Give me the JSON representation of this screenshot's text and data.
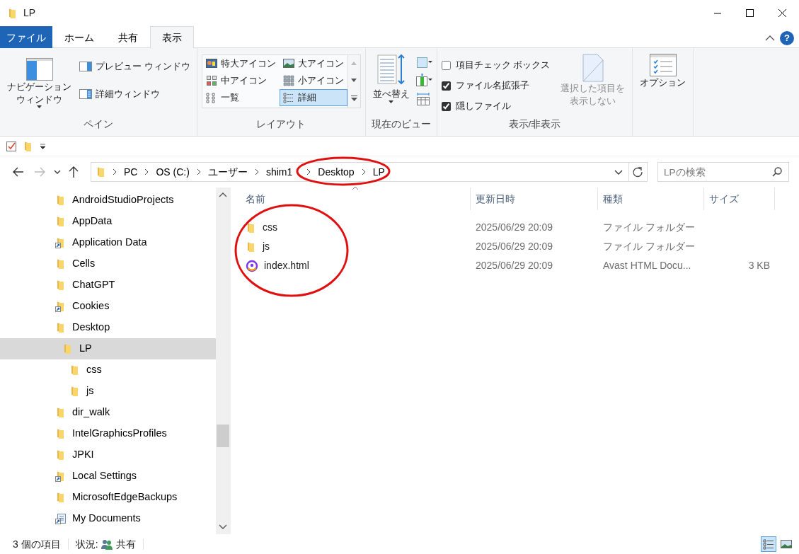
{
  "window": {
    "title": "LP"
  },
  "ribbon_tabs": [
    {
      "label": "ファイル",
      "kind": "file",
      "selected": false
    },
    {
      "label": "ホーム",
      "kind": "tab",
      "selected": false
    },
    {
      "label": "共有",
      "kind": "tab",
      "selected": false
    },
    {
      "label": "表示",
      "kind": "tab",
      "selected": true
    }
  ],
  "help": "?",
  "ribbon_groups": [
    {
      "kind": "panes",
      "label": "ペイン",
      "large": {
        "lines": [
          "ナビゲーション",
          "ウィンドウ"
        ],
        "dropdown": true
      },
      "small": [
        {
          "label": "プレビュー ウィンドウ"
        },
        {
          "label": "詳細ウィンドウ"
        }
      ]
    },
    {
      "kind": "layout",
      "label": "レイアウト",
      "items": [
        {
          "label": "特大アイコン",
          "selected": false
        },
        {
          "label": "大アイコン",
          "selected": false
        },
        {
          "label": "中アイコン",
          "selected": false
        },
        {
          "label": "小アイコン",
          "selected": false
        },
        {
          "label": "一覧",
          "selected": false
        },
        {
          "label": "詳細",
          "selected": true
        }
      ]
    },
    {
      "kind": "view",
      "label": "現在のビュー",
      "large": {
        "lines": [
          "並べ替え"
        ],
        "dropdown": true
      }
    },
    {
      "kind": "showhide",
      "label": "表示/非表示",
      "checks": [
        {
          "label": "項目チェック ボックス",
          "checked": false
        },
        {
          "label": "ファイル名拡張子",
          "checked": true
        },
        {
          "label": "隠しファイル",
          "checked": true
        }
      ],
      "large": {
        "lines": [
          "選択した項目を",
          "表示しない"
        ],
        "disabled": true
      }
    },
    {
      "kind": "options",
      "large": {
        "lines": [
          "オプション"
        ]
      }
    }
  ],
  "address_bar": {
    "crumbs": [
      {
        "label": "PC",
        "circled": false
      },
      {
        "label": "OS (C:)",
        "circled": false
      },
      {
        "label": "ユーザー",
        "circled": false
      },
      {
        "label": "shim1",
        "circled": false
      },
      {
        "label": "Desktop",
        "circled": true
      },
      {
        "label": "LP",
        "circled": true
      }
    ],
    "search": {
      "placeholder": "LPの検索"
    }
  },
  "sidebar": {
    "items": [
      {
        "label": "AndroidStudioProjects",
        "kind": "folder",
        "selected": false
      },
      {
        "label": "AppData",
        "kind": "folder",
        "selected": false
      },
      {
        "label": "Application Data",
        "kind": "shortcut",
        "selected": false
      },
      {
        "label": "Cells",
        "kind": "folder",
        "selected": false
      },
      {
        "label": "ChatGPT",
        "kind": "folder",
        "selected": false
      },
      {
        "label": "Cookies",
        "kind": "shortcut",
        "selected": false
      },
      {
        "label": "Desktop",
        "kind": "folder",
        "selected": false,
        "children": [
          {
            "label": "LP",
            "kind": "folder",
            "selected": true,
            "children": [
              {
                "label": "css",
                "kind": "folder",
                "selected": false
              },
              {
                "label": "js",
                "kind": "folder",
                "selected": false
              }
            ]
          }
        ]
      },
      {
        "label": "dir_walk",
        "kind": "folder",
        "selected": false
      },
      {
        "label": "IntelGraphicsProfiles",
        "kind": "folder",
        "selected": false
      },
      {
        "label": "JPKI",
        "kind": "folder",
        "selected": false
      },
      {
        "label": "Local Settings",
        "kind": "shortcut",
        "selected": false
      },
      {
        "label": "MicrosoftEdgeBackups",
        "kind": "folder",
        "selected": false
      },
      {
        "label": "My Documents",
        "kind": "document",
        "selected": false
      }
    ]
  },
  "file_list": {
    "circled": true,
    "columns": [
      "名前",
      "更新日時",
      "種類",
      "サイズ"
    ],
    "rows": [
      {
        "kind": "folder",
        "name": "css",
        "modified": "2025/06/29 20:09",
        "type": "ファイル フォルダー"
      },
      {
        "kind": "folder",
        "name": "js",
        "modified": "2025/06/29 20:09",
        "type": "ファイル フォルダー"
      },
      {
        "kind": "html",
        "name": "index.html",
        "modified": "2025/06/29 20:09",
        "type": "Avast HTML Docu...",
        "size": "3 KB"
      }
    ]
  },
  "status_bar": {
    "count": "3 個の項目",
    "state_label": "状況:",
    "state": "共有",
    "views": [
      {
        "kind": "details",
        "selected": true
      },
      {
        "kind": "large",
        "selected": false
      }
    ]
  }
}
